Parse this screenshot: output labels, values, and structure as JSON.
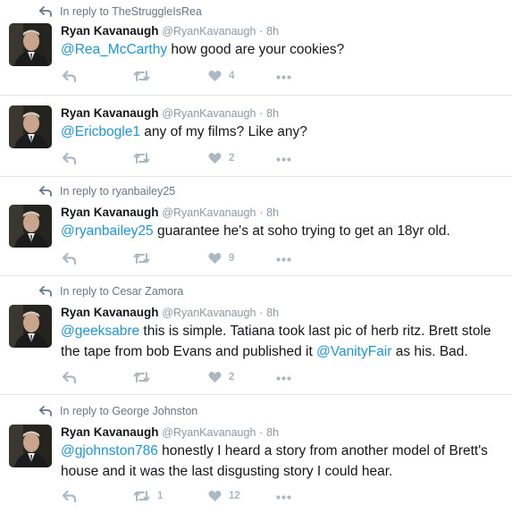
{
  "tweets": [
    {
      "reply_to": "In reply to TheStruggleIsRea",
      "name": "Ryan Kavanaugh",
      "handle": "@RyanKavanaugh",
      "sep": "·",
      "time": "8h",
      "lines": [
        [
          {
            "text": "@Rea_McCarthy",
            "mention": true
          },
          {
            "text": " how good are your cookies?",
            "mention": false
          }
        ]
      ],
      "retweets": "",
      "likes": "4"
    },
    {
      "reply_to": "",
      "name": "Ryan Kavanaugh",
      "handle": "@RyanKavanaugh",
      "sep": "·",
      "time": "8h",
      "lines": [
        [
          {
            "text": "@Ericbogle1",
            "mention": true
          },
          {
            "text": " any of my films? Like any?",
            "mention": false
          }
        ]
      ],
      "retweets": "",
      "likes": "2"
    },
    {
      "reply_to": "In reply to ryanbailey25",
      "name": "Ryan Kavanaugh",
      "handle": "@RyanKavanaugh",
      "sep": "·",
      "time": "8h",
      "lines": [
        [
          {
            "text": "@ryanbailey25",
            "mention": true
          },
          {
            "text": " guarantee he's at soho trying to get an 18yr old.",
            "mention": false
          }
        ]
      ],
      "retweets": "",
      "likes": "9"
    },
    {
      "reply_to": "In reply to Cesar Zamora",
      "name": "Ryan Kavanaugh",
      "handle": "@RyanKavanaugh",
      "sep": "·",
      "time": "8h",
      "lines": [
        [
          {
            "text": "@geeksabre",
            "mention": true
          },
          {
            "text": " this is simple. Tatiana took last pic of herb ritz. Brett stole",
            "mention": false
          }
        ],
        [
          {
            "text": "the tape from bob Evans and published it ",
            "mention": false
          },
          {
            "text": "@VanityFair",
            "mention": true
          },
          {
            "text": " as his. Bad.",
            "mention": false
          }
        ]
      ],
      "retweets": "",
      "likes": "2"
    },
    {
      "reply_to": "In reply to George Johnston",
      "name": "Ryan Kavanaugh",
      "handle": "@RyanKavanaugh",
      "sep": "·",
      "time": "8h",
      "lines": [
        [
          {
            "text": "@gjohnston786",
            "mention": true
          },
          {
            "text": " honestly I heard a story from another model of Brett's",
            "mention": false
          }
        ],
        [
          {
            "text": "house and it was the last disgusting story I could hear.",
            "mention": false
          }
        ]
      ],
      "retweets": "1",
      "likes": "12"
    }
  ]
}
